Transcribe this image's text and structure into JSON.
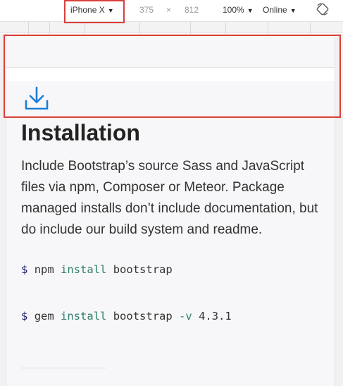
{
  "toolbar": {
    "device": "iPhone X",
    "width": "375",
    "times": "×",
    "height": "812",
    "zoom": "100%",
    "network": "Online"
  },
  "page": {
    "title": "Installation",
    "description": "Include Bootstrap’s source Sass and JavaScript files via npm, Composer or Meteor. Package managed installs don’t include documentation, but do include our build system and readme.",
    "code": [
      {
        "prompt": "$",
        "cmd": "npm",
        "kw": "install",
        "arg": "bootstrap",
        "flag": "",
        "ver": ""
      },
      {
        "prompt": "$",
        "cmd": "gem",
        "kw": "install",
        "arg": "bootstrap",
        "flag": "-v",
        "ver": "4.3.1"
      }
    ]
  },
  "colors": {
    "highlight": "#d9403a",
    "icon": "#1b7ed6"
  }
}
